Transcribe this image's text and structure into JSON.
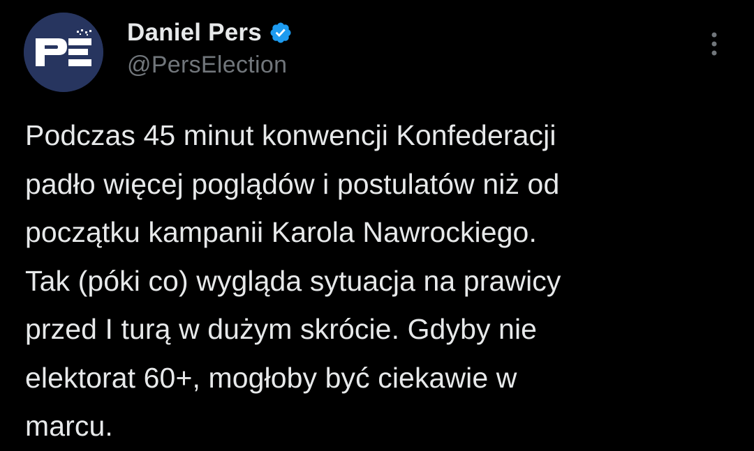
{
  "author": {
    "display_name": "Daniel Pers",
    "handle": "@PersElection",
    "verified": true,
    "avatar_text": "PE"
  },
  "icons": {
    "verified": "verified-badge-icon",
    "more": "more-options-icon"
  },
  "colors": {
    "background": "#000000",
    "text_primary": "#e7e9ea",
    "text_secondary": "#71767b",
    "verified_blue": "#1d9bf0",
    "avatar_background": "#27355f"
  },
  "tweet": {
    "text": "Podczas 45 minut konwencji Konfederacji\npadło więcej poglądów i postulatów niż od\npoczątku kampanii Karola Nawrockiego.\nTak (póki co) wygląda sytuacja na prawicy\nprzed I turą w dużym skrócie. Gdyby nie\nelektorat 60+, mogłoby być ciekawie w\nmarcu."
  }
}
